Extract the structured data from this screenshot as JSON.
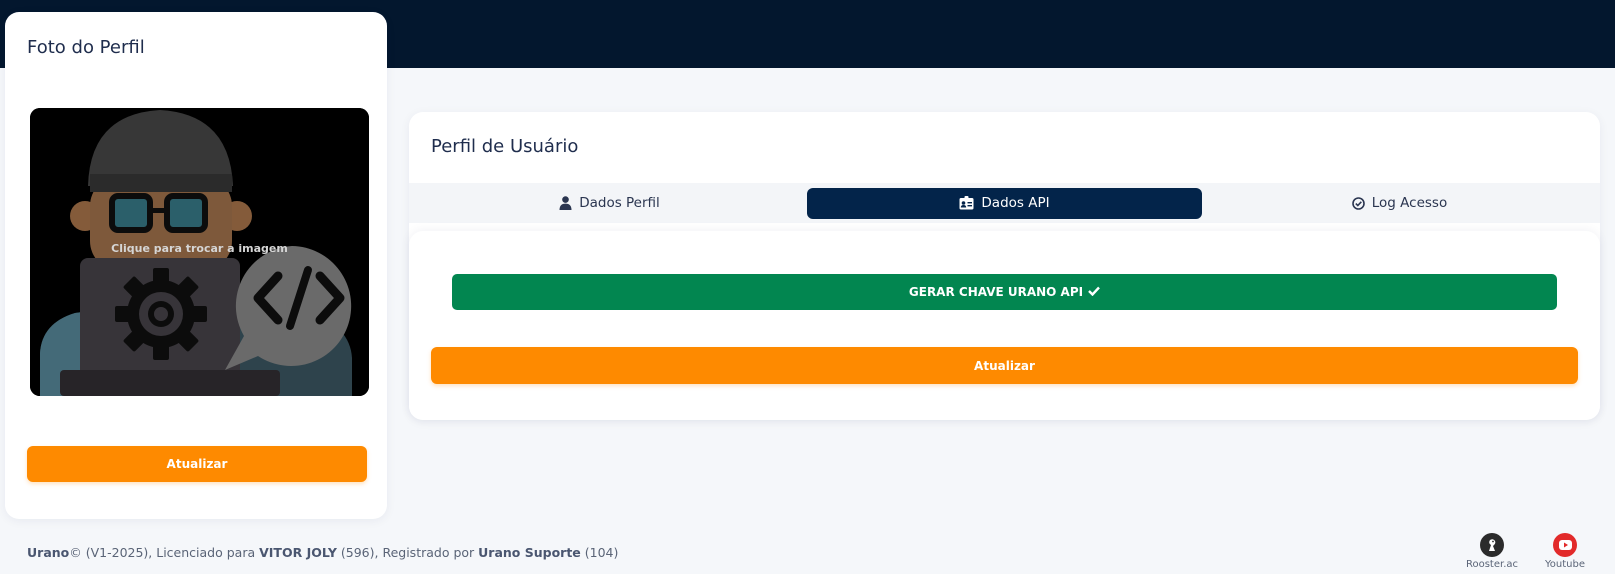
{
  "photo_card": {
    "title": "Foto do Perfil",
    "change_hint": "Clique para trocar a imagem",
    "update_label": "Atualizar"
  },
  "profile_card": {
    "title": "Perfil de Usuário",
    "tabs": [
      {
        "label": "Dados Perfil",
        "icon": "user-icon",
        "active": false
      },
      {
        "label": "Dados API",
        "icon": "id-card-icon",
        "active": true
      },
      {
        "label": "Log Acesso",
        "icon": "check-circle-icon",
        "active": false
      }
    ],
    "generate_key_label": "GERAR CHAVE URANO API",
    "update_label": "Atualizar"
  },
  "footer": {
    "brand": "Urano",
    "copyright": "© (V1-2025), Licenciado para ",
    "licensee": "VITOR JOLY",
    "licensee_id": " (596), Registrado por ",
    "registrar": "Urano Suporte",
    "registrar_id": " (104)"
  },
  "social": {
    "rooster_label": "Rooster.ac",
    "youtube_label": "Youtube"
  },
  "colors": {
    "topbar": "#03172e",
    "accent_orange": "#fe8a00",
    "accent_green": "#028650",
    "active_tab": "#03244a"
  }
}
